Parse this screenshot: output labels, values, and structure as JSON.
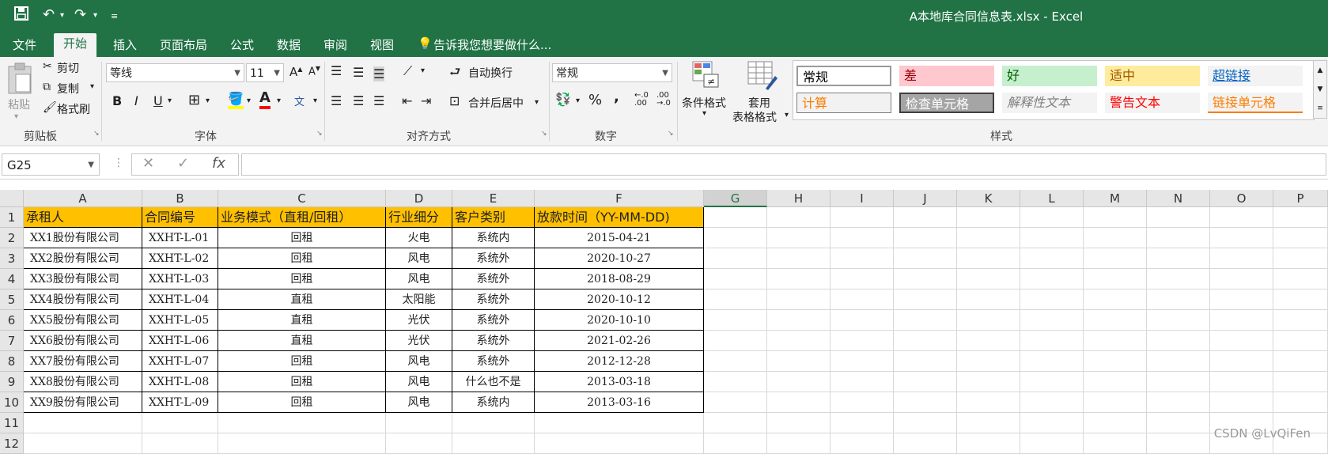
{
  "window": {
    "title": "A本地库合同信息表.xlsx  -  Excel"
  },
  "quick_access": {
    "save_icon": "save-icon",
    "undo_icon": "undo-icon",
    "redo_icon": "redo-icon",
    "customize_icon": "customize-icon"
  },
  "menu": {
    "file": "文件",
    "home": "开始",
    "insert": "插入",
    "page_layout": "页面布局",
    "formulas": "公式",
    "data": "数据",
    "review": "审阅",
    "view": "视图",
    "tell_me": "告诉我您想要做什么..."
  },
  "ribbon": {
    "clipboard": {
      "paste": "粘贴",
      "cut": "剪切",
      "copy": "复制",
      "format_painter": "格式刷",
      "label": "剪贴板"
    },
    "font": {
      "name": "等线",
      "size": "11",
      "grow": "A",
      "shrink": "A",
      "bold": "B",
      "italic": "I",
      "underline": "U",
      "font_color_letter": "A",
      "phonetic": "wén",
      "label": "字体"
    },
    "alignment": {
      "wrap": "自动换行",
      "merge": "合并后居中",
      "label": "对齐方式"
    },
    "number": {
      "format": "常规",
      "percent": "%",
      "comma": ",",
      "inc_dec": ".0\n.00",
      "dec_dec": ".00\n→.0",
      "label": "数字"
    },
    "conditional": "条件格式",
    "table_format_1": "套用",
    "table_format_2": "表格格式",
    "styles": {
      "label": "样式",
      "items": [
        {
          "text": "常规",
          "bg": "#ffffff",
          "color": "#000000"
        },
        {
          "text": "差",
          "bg": "#ffc7ce",
          "color": "#9c0006"
        },
        {
          "text": "好",
          "bg": "#c6efce",
          "color": "#006100"
        },
        {
          "text": "适中",
          "bg": "#ffeb9c",
          "color": "#9c5700"
        },
        {
          "text": "超链接",
          "bg": "#f3f3f3",
          "color": "#0563c1"
        },
        {
          "text": "计算",
          "bg": "#f2f2f2",
          "color": "#fa7d00"
        },
        {
          "text": "检查单元格",
          "bg": "#a5a5a5",
          "color": "#ffffff"
        },
        {
          "text": "解释性文本",
          "bg": "#f3f3f3",
          "color": "#7f7f7f"
        },
        {
          "text": "警告文本",
          "bg": "#f3f3f3",
          "color": "#ff0000"
        },
        {
          "text": "链接单元格",
          "bg": "#f3f3f3",
          "color": "#fa7d00"
        }
      ]
    }
  },
  "formula_bar": {
    "name_box": "G25",
    "cancel": "✕",
    "enter": "✓",
    "fx": "fx",
    "value": ""
  },
  "sheet": {
    "columns": [
      "A",
      "B",
      "C",
      "D",
      "E",
      "F",
      "G",
      "H",
      "I",
      "J",
      "K",
      "L",
      "M",
      "N",
      "O",
      "P"
    ],
    "selected_column": "G",
    "row_numbers": [
      "1",
      "2",
      "3",
      "4",
      "5",
      "6",
      "7",
      "8",
      "9",
      "10",
      "11",
      "12"
    ],
    "header": [
      "承租人",
      "合同编号",
      "业务模式（直租/回租）",
      "行业细分",
      "客户类别",
      "放款时间（YY-MM-DD)"
    ],
    "rows": [
      [
        "XX1股份有限公司",
        "XXHT-L-01",
        "回租",
        "火电",
        "系统内",
        "2015-04-21"
      ],
      [
        "XX2股份有限公司",
        "XXHT-L-02",
        "回租",
        "风电",
        "系统外",
        "2020-10-27"
      ],
      [
        "XX3股份有限公司",
        "XXHT-L-03",
        "回租",
        "风电",
        "系统外",
        "2018-08-29"
      ],
      [
        "XX4股份有限公司",
        "XXHT-L-04",
        "直租",
        "太阳能",
        "系统外",
        "2020-10-12"
      ],
      [
        "XX5股份有限公司",
        "XXHT-L-05",
        "直租",
        "光伏",
        "系统外",
        "2020-10-10"
      ],
      [
        "XX6股份有限公司",
        "XXHT-L-06",
        "直租",
        "光伏",
        "系统外",
        "2021-02-26"
      ],
      [
        "XX7股份有限公司",
        "XXHT-L-07",
        "回租",
        "风电",
        "系统外",
        "2012-12-28"
      ],
      [
        "XX8股份有限公司",
        "XXHT-L-08",
        "回租",
        "风电",
        "什么也不是",
        "2013-03-18"
      ],
      [
        "XX9股份有限公司",
        "XXHT-L-09",
        "回租",
        "风电",
        "系统内",
        "2013-03-16"
      ]
    ]
  },
  "watermark": "CSDN @LvQiFen",
  "colors": {
    "excel_green": "#217346",
    "header_fill": "#ffc000"
  }
}
